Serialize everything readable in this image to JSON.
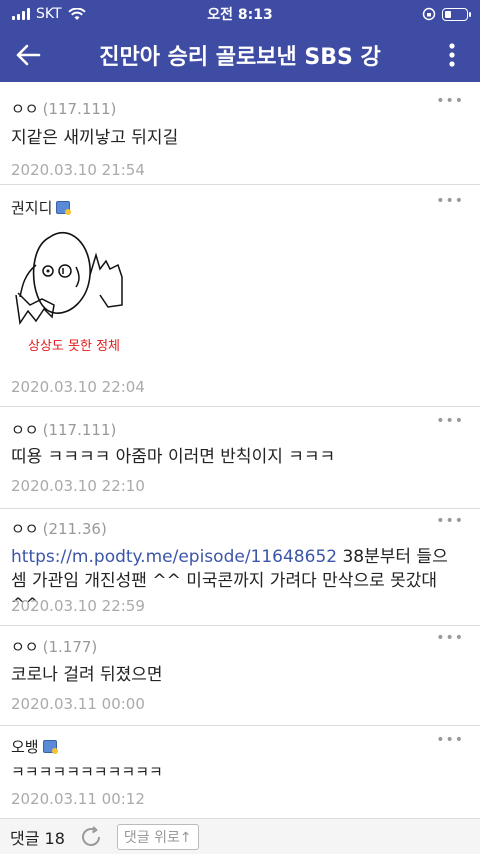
{
  "statusbar": {
    "carrier": "SKT",
    "time": "오전 8:13",
    "battery_level": 0.3
  },
  "appbar": {
    "title": "진만아 승리 골로보낸 SBS 강",
    "back_icon": "back-arrow-icon",
    "more_icon": "more-vert-icon"
  },
  "comments": [
    {
      "author": "ㅇㅇ",
      "ip": "(117.111)",
      "text": "지같은 새끼낳고 뒤지길",
      "date": "2020.03.10 21:54"
    },
    {
      "author": "권지디",
      "image_caption": "상상도 못한 정체",
      "date": "2020.03.10 22:04"
    },
    {
      "author": "ㅇㅇ",
      "ip": "(117.111)",
      "text": "띠용 ㅋㅋㅋㅋ 아줌마 이러면 반칙이지 ㅋㅋㅋ",
      "date": "2020.03.10 22:10"
    },
    {
      "author": "ㅇㅇ",
      "ip": "(211.36)",
      "link": "https://m.podty.me/episode/11648652",
      "text_line1": " 38분부터 들으",
      "text_line2": "셈 가관임 개진성팬 ^^ 미국콘까지 가려다 만삭으로 못갔대 ^^",
      "date": "2020.03.10 22:59"
    },
    {
      "author": "ㅇㅇ",
      "ip": "(1.177)",
      "text": "코로나 걸려 뒤졌으면",
      "date": "2020.03.11 00:00"
    },
    {
      "author": "오뱅",
      "text": "ㅋㅋㅋㅋㅋㅋㅋㅋㅋㅋㅋ",
      "date": "2020.03.11 00:12"
    }
  ],
  "bottombar": {
    "count_label": "댓글 18",
    "up_label": "댓글 위로↑"
  }
}
